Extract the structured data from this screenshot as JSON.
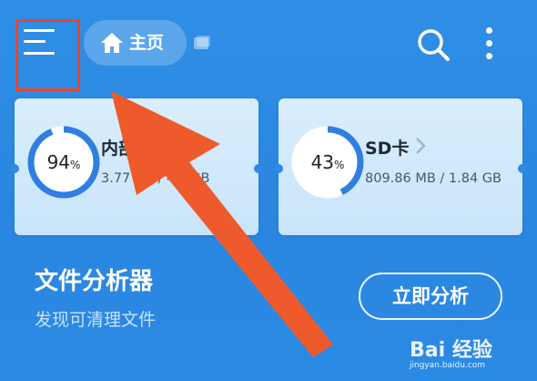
{
  "header": {
    "home_label": "主页",
    "menu_icon": "hamburger-menu-icon",
    "search_icon": "search-icon",
    "more_icon": "more-vertical-icon"
  },
  "storage": [
    {
      "name": "内部",
      "percent": 94,
      "percent_unit": "%",
      "size": "3.77 GB / 4.? GB",
      "used_fraction": 0.94
    },
    {
      "name": "SD卡",
      "percent": 43,
      "percent_unit": "%",
      "size": "809.86 MB / 1.84 GB",
      "used_fraction": 0.43
    }
  ],
  "analyzer": {
    "title": "文件分析器",
    "subtitle": "发现可清理文件",
    "button_label": "立即分析"
  },
  "watermark": {
    "text": "Bai 经验",
    "sub": "jingyan.baidu.com"
  },
  "colors": {
    "accent": "#2b8ae4",
    "highlight": "#e8452c",
    "ring": "#2f7fe0",
    "ring_track": "#ffffff"
  }
}
